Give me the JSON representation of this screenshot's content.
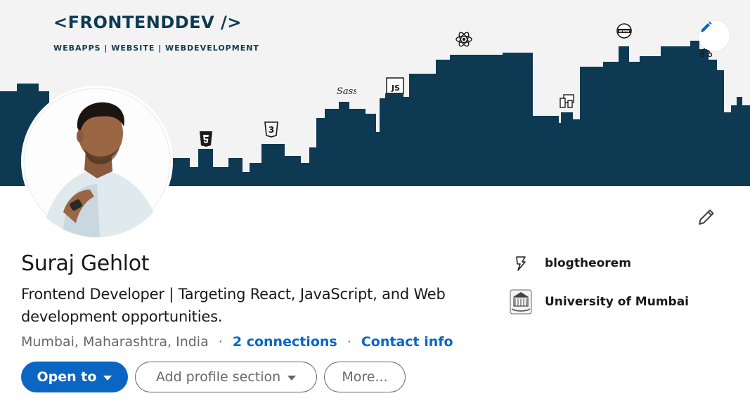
{
  "banner": {
    "brand_title": "<FRONTENDDEV />",
    "brand_subtitle": "WEBAPPS | WEBSITE | WEBDEVELOPMENT",
    "skyline_color": "#0d3a52",
    "background_color": "#f3f3f3",
    "icons": [
      "html5-icon",
      "css3-icon",
      "sass-icon",
      "javascript-icon",
      "react-icon",
      "responsive-devices-icon",
      "www-globe-icon",
      "git-branch-icon"
    ],
    "edit_icon": "pencil-icon"
  },
  "profile": {
    "name": "Suraj Gehlot",
    "headline": "Frontend Developer | Targeting React, JavaScript, and Web development opportunities.",
    "location": "Mumbai, Maharashtra, India",
    "separator": "·",
    "connections_label": "2 connections",
    "contact_info_label": "Contact info",
    "edit_icon": "pencil-icon"
  },
  "actions": {
    "open_to_label": "Open to",
    "add_section_label": "Add profile section",
    "more_label": "More..."
  },
  "sidebar": {
    "company": {
      "label": "blogtheorem",
      "icon": "blogtheorem-logo-icon"
    },
    "education": {
      "label": "University of Mumbai",
      "icon": "university-crest-icon"
    }
  },
  "colors": {
    "primary": "#0a66c2",
    "text": "#191919",
    "muted": "#666666"
  }
}
